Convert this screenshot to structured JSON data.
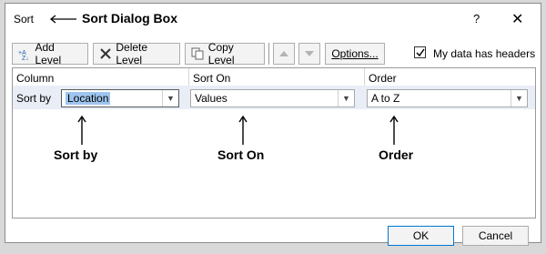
{
  "dialog": {
    "title": "Sort",
    "title_annotation": "Sort Dialog Box",
    "help_label": "?",
    "close_label": "✕"
  },
  "toolbar": {
    "add_level": "Add Level",
    "delete_level": "Delete Level",
    "copy_level": "Copy Level",
    "options": "Options...",
    "headers_label": "My data has headers",
    "headers_checked": true
  },
  "columns": {
    "column": "Column",
    "sort_on": "Sort On",
    "order": "Order"
  },
  "row": {
    "sort_by_label": "Sort by",
    "column_value": "Location",
    "sort_on_value": "Values",
    "order_value": "A to Z"
  },
  "annotations": {
    "sort_by": "Sort by",
    "sort_on": "Sort On",
    "order": "Order"
  },
  "buttons": {
    "ok": "OK",
    "cancel": "Cancel"
  }
}
